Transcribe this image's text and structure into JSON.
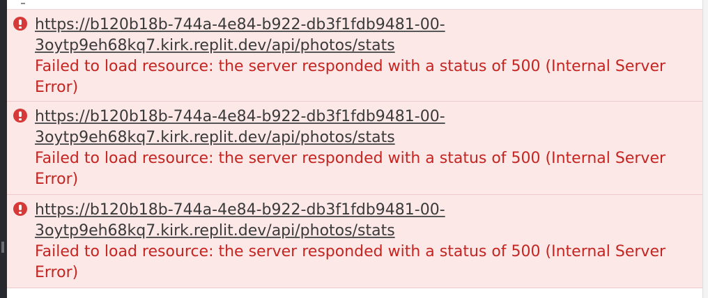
{
  "console": {
    "errors": [
      {
        "icon": "error-circle-icon",
        "url_line1": "https://b120b18b-744a-4e84-b922-db3f1fdb9481-00-",
        "url_line2": "3oytp9eh68kq7.kirk.replit.dev/api/photos/stats",
        "message": "Failed to load resource: the server responded with a status of 500 (Internal Server Error)"
      },
      {
        "icon": "error-circle-icon",
        "url_line1": "https://b120b18b-744a-4e84-b922-db3f1fdb9481-00-",
        "url_line2": "3oytp9eh68kq7.kirk.replit.dev/api/photos/stats",
        "message": "Failed to load resource: the server responded with a status of 500 (Internal Server Error)"
      },
      {
        "icon": "error-circle-icon",
        "url_line1": "https://b120b18b-744a-4e84-b922-db3f1fdb9481-00-",
        "url_line2": "3oytp9eh68kq7.kirk.replit.dev/api/photos/stats",
        "message": "Failed to load resource: the server responded with a status of 500 (Internal Server Error)"
      }
    ]
  },
  "colors": {
    "error_background": "#fde8e8",
    "error_text": "#c42521",
    "error_icon": "#d63a38",
    "link_text": "#3a3a3a"
  }
}
